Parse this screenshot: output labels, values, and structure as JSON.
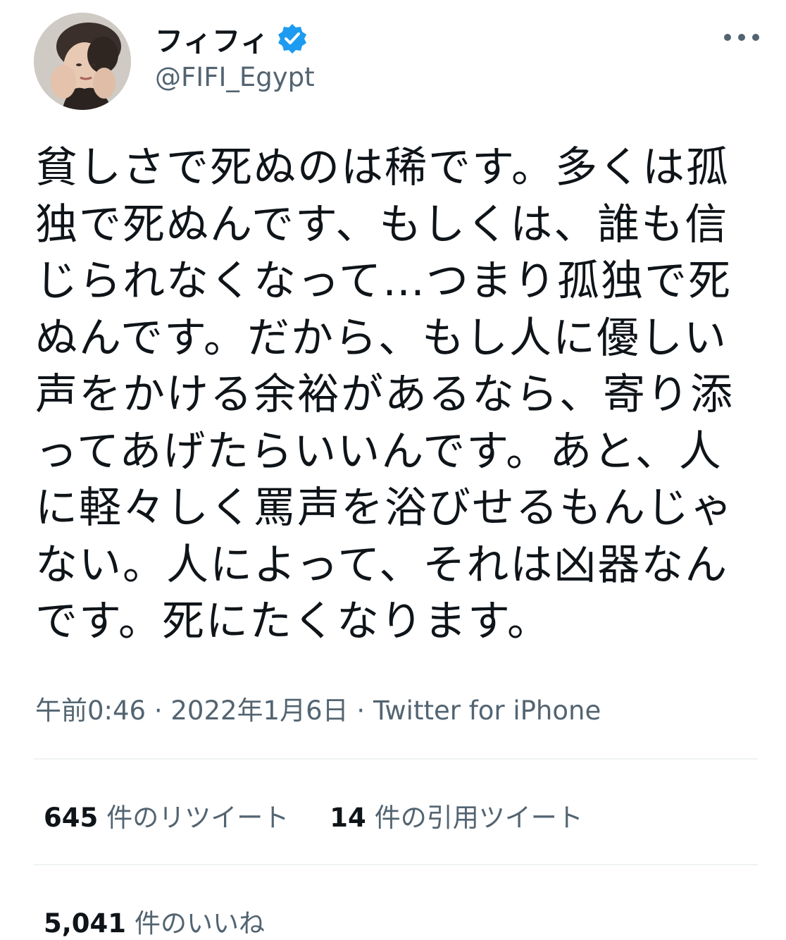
{
  "user": {
    "display_name": "フィフィ",
    "handle": "@FIFI_Egypt",
    "verified": true
  },
  "tweet": {
    "lines": [
      "貧しさで死ぬのは稀です。多くは孤",
      "独で死ぬんです、もしくは、誰も信",
      "じられなくなって…つまり孤独で死",
      "ぬんです。だから、もし人に優しい",
      "声をかける余裕があるなら、寄り添",
      "ってあげたらいいんです。あと、人",
      "に軽々しく罵声を浴びせるもんじゃ",
      "ない。人によって、それは凶器なん",
      "です。死にたくなります。"
    ],
    "time": "午前0:46",
    "separator": "·",
    "date": "2022年1月6日",
    "source": "Twitter for iPhone"
  },
  "stats": {
    "retweets": {
      "count": "645",
      "label": "件のリツイート"
    },
    "quotes": {
      "count": "14",
      "label": "件の引用ツイート"
    },
    "likes": {
      "count": "5,041",
      "label": "件のいいね"
    }
  },
  "colors": {
    "text": "#0f1419",
    "secondary": "#536471",
    "verified": "#1d9bf0",
    "divider": "#eff3f4"
  },
  "icons": {
    "verified": "verified-badge-icon",
    "more": "more-dots-icon"
  }
}
